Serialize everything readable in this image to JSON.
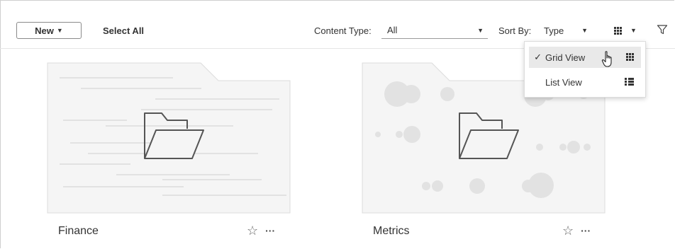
{
  "toolbar": {
    "new_label": "New",
    "select_all_label": "Select All",
    "content_type_label": "Content Type:",
    "content_type_value": "All",
    "sort_by_label": "Sort By:",
    "sort_by_value": "Type"
  },
  "view_menu": {
    "items": [
      {
        "label": "Grid View",
        "checked": true,
        "icon": "grid-icon"
      },
      {
        "label": "List View",
        "checked": false,
        "icon": "list-icon"
      }
    ],
    "check_mark": "✓"
  },
  "cards": [
    {
      "title": "Finance",
      "thumbnail": "folder-lines"
    },
    {
      "title": "Metrics",
      "thumbnail": "folder-bubbles"
    }
  ],
  "icons": {
    "star": "☆",
    "more": "···",
    "caret": "▼"
  },
  "colors": {
    "thumb_fill": "#f5f5f5",
    "thumb_stroke": "#dcdcdc",
    "decor": "#e2e2e2",
    "menu_hover": "#e9e9e9"
  }
}
